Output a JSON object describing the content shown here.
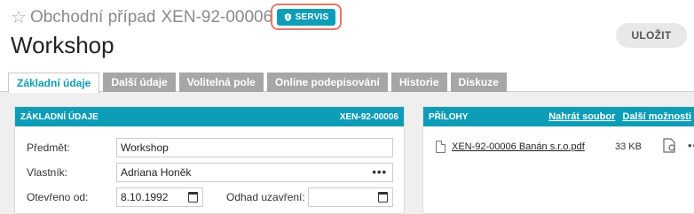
{
  "header": {
    "breadcrumb_type": "Obchodní případ",
    "record_number": "XEN-92-00006",
    "badge_label": "SERVIS",
    "title": "Workshop",
    "save_label": "ULOŽIT"
  },
  "tabs": [
    {
      "label": "Základní údaje",
      "active": true
    },
    {
      "label": "Další údaje",
      "active": false
    },
    {
      "label": "Volitelná pole",
      "active": false
    },
    {
      "label": "Online podepisování",
      "active": false
    },
    {
      "label": "Historie",
      "active": false
    },
    {
      "label": "Diskuze",
      "active": false
    }
  ],
  "basic_panel": {
    "title": "ZÁKLADNÍ ÚDAJE",
    "record_number": "XEN-92-00006",
    "subject_label": "Předmět:",
    "subject_value": "Workshop",
    "owner_label": "Vlastník:",
    "owner_value": "Adriana Honěk",
    "opened_label": "Otevřeno od:",
    "opened_value": "8.10.1992",
    "close_label": "Odhad uzavření:",
    "close_value": ""
  },
  "attachments_panel": {
    "title": "PŘÍLOHY",
    "upload_link": "Nahrát soubor",
    "more_link": "Další možnosti",
    "files": [
      {
        "name": "XEN-92-00006 Banán s.r.o.pdf",
        "size": "33 KB"
      }
    ]
  },
  "colors": {
    "accent": "#0e9db6",
    "badge_highlight": "#e07a6a",
    "tab_inactive": "#a6a6a6"
  },
  "icons": [
    "star-icon",
    "shield-icon",
    "calendar-icon",
    "more-icon",
    "file-icon",
    "attach-icon"
  ]
}
